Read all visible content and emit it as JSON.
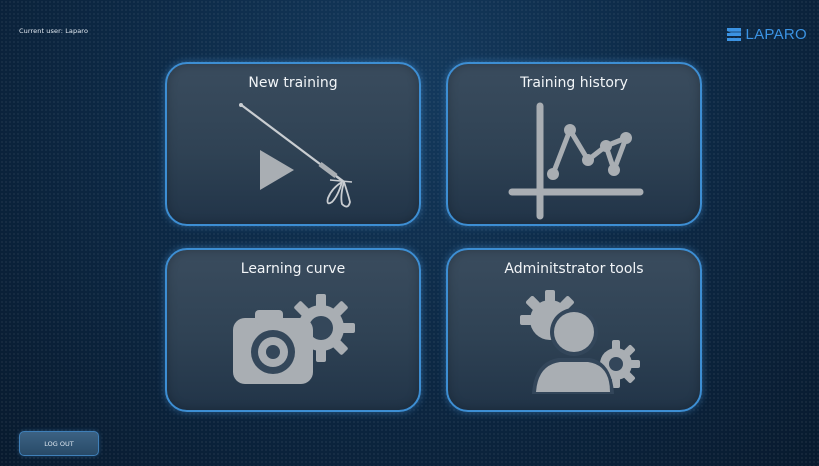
{
  "header": {
    "current_user": "Current user: Laparo",
    "logo_text": "LAPARO",
    "logo_color": "#3b93e3"
  },
  "tiles": [
    {
      "label": "New training",
      "icon": "laparoscopic-instrument-play-icon"
    },
    {
      "label": "Training history",
      "icon": "line-chart-icon"
    },
    {
      "label": "Learning curve",
      "icon": "camera-gear-icon"
    },
    {
      "label": "Adminitstrator tools",
      "icon": "user-gears-icon"
    }
  ],
  "footer": {
    "logout_label": "LOG OUT"
  },
  "colors": {
    "tile_border": "#3d8ed3",
    "icon_gray": "#a9aeb3"
  }
}
